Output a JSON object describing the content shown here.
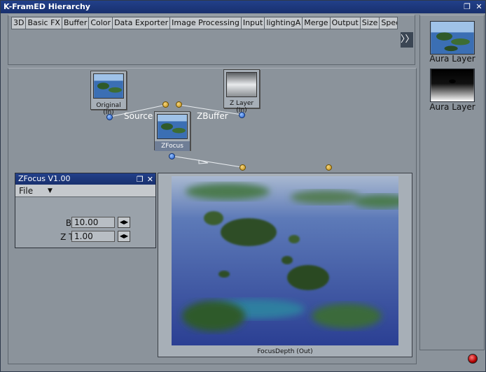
{
  "window": {
    "title": "K-FramED Hierarchy"
  },
  "tabs": [
    "3D",
    "Basic FX",
    "Buffer",
    "Color",
    "Data Exporter",
    "Image Processing",
    "Input",
    "lightingA",
    "Merge",
    "Output",
    "Size",
    "Special F"
  ],
  "tab_scroll_label": "〉〉",
  "sidebar": {
    "items": [
      {
        "label": "Aura Layer"
      },
      {
        "label": "Aura Layer"
      }
    ]
  },
  "nodes": {
    "original": {
      "label": "Original (In)"
    },
    "zlayer": {
      "label": "Z Layer (In)"
    },
    "zfocus": {
      "label": "ZFocus"
    },
    "output": {
      "label": "FocusDepth (Out)"
    }
  },
  "connections": {
    "source_label": "Source",
    "zbuffer_label": "ZBuffer"
  },
  "zfocus_panel": {
    "title": "ZFocus V1.00",
    "menu_file": "File",
    "params": [
      {
        "label": "Blur",
        "value": "10.00"
      },
      {
        "label": "Z Tol.",
        "value": "1.00"
      }
    ]
  },
  "colors": {
    "titlebar": "#1e3a80",
    "background": "#8b939b",
    "status_led": "#c00000"
  }
}
